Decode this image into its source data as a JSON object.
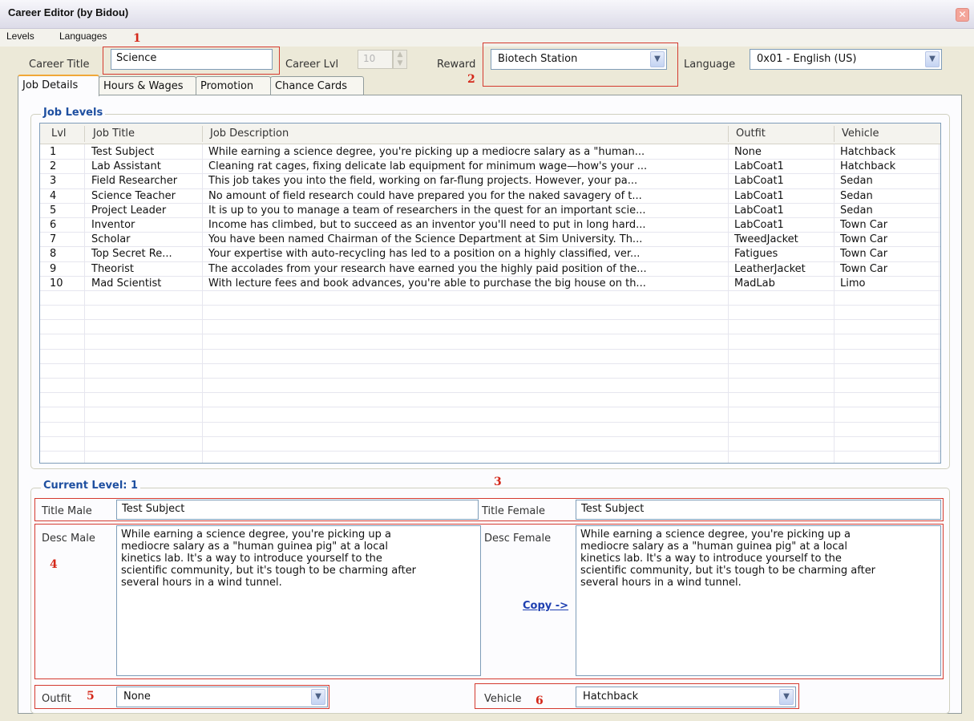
{
  "window": {
    "title": "Career Editor (by Bidou)",
    "close_glyph": "✕"
  },
  "menu": {
    "items": [
      "Levels",
      "Languages"
    ]
  },
  "annotations": [
    "1",
    "2",
    "3",
    "4",
    "5",
    "6"
  ],
  "header": {
    "career_title_label": "Career Title",
    "career_title_value": "Science",
    "career_lvl_label": "Career Lvl",
    "career_lvl_value": "10",
    "reward_label": "Reward",
    "reward_value": "Biotech Station",
    "language_label": "Language",
    "language_value": "0x01 - English (US)"
  },
  "tabs": [
    "Job Details",
    "Hours & Wages",
    "Promotion",
    "Chance Cards"
  ],
  "job_levels": {
    "title": "Job Levels",
    "columns": [
      "Lvl",
      "Job Title",
      "Job Description",
      "Outfit",
      "Vehicle"
    ],
    "rows": [
      [
        "1",
        "Test Subject",
        "While earning a science degree, you're picking up a mediocre salary as a \"human...",
        "None",
        "Hatchback"
      ],
      [
        "2",
        "Lab Assistant",
        "Cleaning rat cages, fixing delicate lab equipment for minimum wage—how's your ...",
        "LabCoat1",
        "Hatchback"
      ],
      [
        "3",
        "Field Researcher",
        "This job takes you into the field, working on far-flung projects. However, your pa...",
        "LabCoat1",
        "Sedan"
      ],
      [
        "4",
        "Science Teacher",
        "No amount of field research could have prepared you for the naked savagery of t...",
        "LabCoat1",
        "Sedan"
      ],
      [
        "5",
        "Project Leader",
        "It is up to you to manage a team of researchers in the quest for an important scie...",
        "LabCoat1",
        "Sedan"
      ],
      [
        "6",
        "Inventor",
        "Income has climbed, but to succeed as an inventor you'll need to put in long hard...",
        "LabCoat1",
        "Town Car"
      ],
      [
        "7",
        "Scholar",
        "You have been named Chairman of the Science Department at Sim University. Th...",
        "TweedJacket",
        "Town Car"
      ],
      [
        "8",
        "Top Secret Re...",
        "Your expertise with auto-recycling has led to a position on a highly classified, ver...",
        "Fatigues",
        "Town Car"
      ],
      [
        "9",
        "Theorist",
        "The accolades from your research have earned you the highly paid position of the...",
        "LeatherJacket",
        "Town Car"
      ],
      [
        "10",
        "Mad Scientist",
        "With lecture fees and book advances, you're able to purchase the big house on th...",
        "MadLab",
        "Limo"
      ]
    ]
  },
  "current_level": {
    "title": "Current Level: 1",
    "title_male_label": "Title Male",
    "title_male_value": "Test Subject",
    "title_female_label": "Title Female",
    "title_female_value": "Test Subject",
    "desc_male_label": "Desc Male",
    "desc_male_value": "While earning a science degree, you're picking up a\nmediocre salary as a \"human guinea pig\" at a local\nkinetics lab. It's a way to introduce yourself to the\nscientific community, but it's tough to be charming after\nseveral hours in a wind tunnel.",
    "desc_female_label": "Desc Female",
    "desc_female_value": "While earning a science degree, you're picking up a\nmediocre salary as a \"human guinea pig\" at a local\nkinetics lab. It's a way to introduce yourself to the\nscientific community, but it's tough to be charming after\nseveral hours in a wind tunnel.",
    "copy_label": "Copy ->",
    "outfit_label": "Outfit",
    "outfit_value": "None",
    "vehicle_label": "Vehicle",
    "vehicle_value": "Hatchback"
  },
  "colors": {
    "annotation": "#d4281a",
    "group_title": "#1e4fa0",
    "link": "#1e3fb0"
  }
}
